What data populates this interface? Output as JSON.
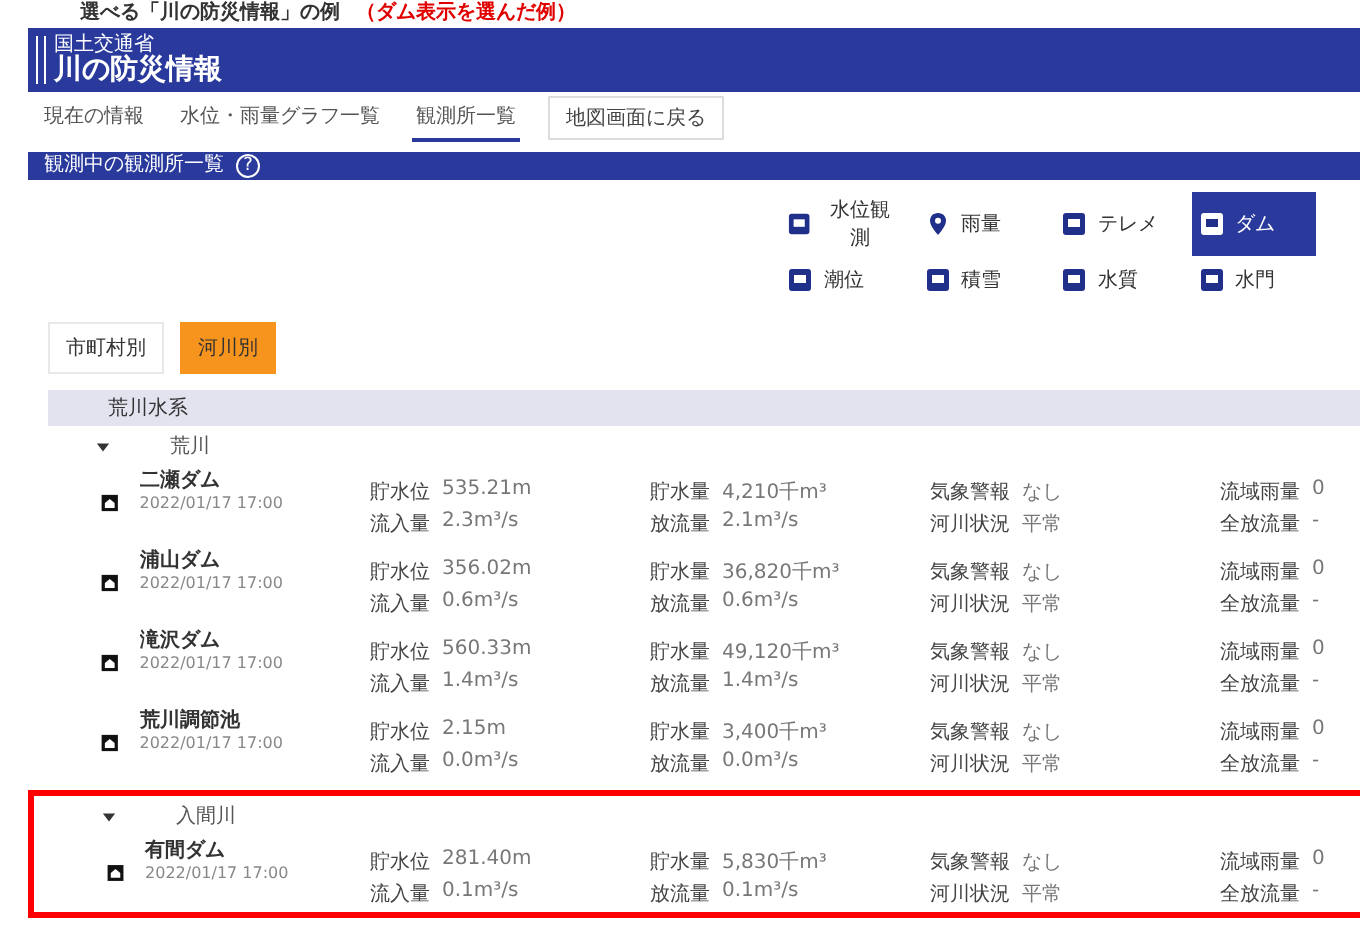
{
  "caption": {
    "text": "選べる「川の防災情報」の例",
    "note": "（ダム表示を選んだ例）"
  },
  "header": {
    "ministry": "国土交通省",
    "title": "川の防災情報"
  },
  "tabs": [
    {
      "label": "現在の情報",
      "selected": false
    },
    {
      "label": "水位・雨量グラフ一覧",
      "selected": false
    },
    {
      "label": "観測所一覧",
      "selected": true
    }
  ],
  "map_button": "地図画面に戻る",
  "section": {
    "title": "観測中の観測所一覧",
    "help": "?"
  },
  "filters": [
    {
      "label": "水位観測",
      "selected": false
    },
    {
      "label": "雨量",
      "selected": false
    },
    {
      "label": "テレメ",
      "selected": false
    },
    {
      "label": "ダム",
      "selected": true
    },
    {
      "label": "潮位",
      "selected": false
    },
    {
      "label": "積雪",
      "selected": false
    },
    {
      "label": "水質",
      "selected": false
    },
    {
      "label": "水門",
      "selected": false
    }
  ],
  "sort_buttons": [
    {
      "label": "市町村別",
      "selected": false
    },
    {
      "label": "河川別",
      "selected": true
    }
  ],
  "basin": "荒川水系",
  "groups": [
    {
      "name": "荒川",
      "expanded": true,
      "highlighted": false,
      "dams": [
        {
          "name": "二瀬ダム",
          "time": "2022/01/17 17:00",
          "fields": [
            [
              "貯水位",
              "535.21m"
            ],
            [
              "流入量",
              "2.3m³/s"
            ],
            [
              "貯水量",
              "4,210千m³"
            ],
            [
              "放流量",
              "2.1m³/s"
            ],
            [
              "気象警報",
              "なし"
            ],
            [
              "河川状況",
              "平常"
            ],
            [
              "流域雨量",
              "0"
            ],
            [
              "全放流量",
              "-"
            ]
          ]
        },
        {
          "name": "浦山ダム",
          "time": "2022/01/17 17:00",
          "fields": [
            [
              "貯水位",
              "356.02m"
            ],
            [
              "流入量",
              "0.6m³/s"
            ],
            [
              "貯水量",
              "36,820千m³"
            ],
            [
              "放流量",
              "0.6m³/s"
            ],
            [
              "気象警報",
              "なし"
            ],
            [
              "河川状況",
              "平常"
            ],
            [
              "流域雨量",
              "0"
            ],
            [
              "全放流量",
              "-"
            ]
          ]
        },
        {
          "name": "滝沢ダム",
          "time": "2022/01/17 17:00",
          "fields": [
            [
              "貯水位",
              "560.33m"
            ],
            [
              "流入量",
              "1.4m³/s"
            ],
            [
              "貯水量",
              "49,120千m³"
            ],
            [
              "放流量",
              "1.4m³/s"
            ],
            [
              "気象警報",
              "なし"
            ],
            [
              "河川状況",
              "平常"
            ],
            [
              "流域雨量",
              "0"
            ],
            [
              "全放流量",
              "-"
            ]
          ]
        },
        {
          "name": "荒川調節池",
          "time": "2022/01/17 17:00",
          "fields": [
            [
              "貯水位",
              "2.15m"
            ],
            [
              "流入量",
              "0.0m³/s"
            ],
            [
              "貯水量",
              "3,400千m³"
            ],
            [
              "放流量",
              "0.0m³/s"
            ],
            [
              "気象警報",
              "なし"
            ],
            [
              "河川状況",
              "平常"
            ],
            [
              "流域雨量",
              "0"
            ],
            [
              "全放流量",
              "-"
            ]
          ]
        }
      ]
    },
    {
      "name": "入間川",
      "expanded": true,
      "highlighted": true,
      "dams": [
        {
          "name": "有間ダム",
          "time": "2022/01/17 17:00",
          "fields": [
            [
              "貯水位",
              "281.40m"
            ],
            [
              "流入量",
              "0.1m³/s"
            ],
            [
              "貯水量",
              "5,830千m³"
            ],
            [
              "放流量",
              "0.1m³/s"
            ],
            [
              "気象警報",
              "なし"
            ],
            [
              "河川状況",
              "平常"
            ],
            [
              "流域雨量",
              "0"
            ],
            [
              "全放流量",
              "-"
            ]
          ]
        }
      ]
    }
  ]
}
